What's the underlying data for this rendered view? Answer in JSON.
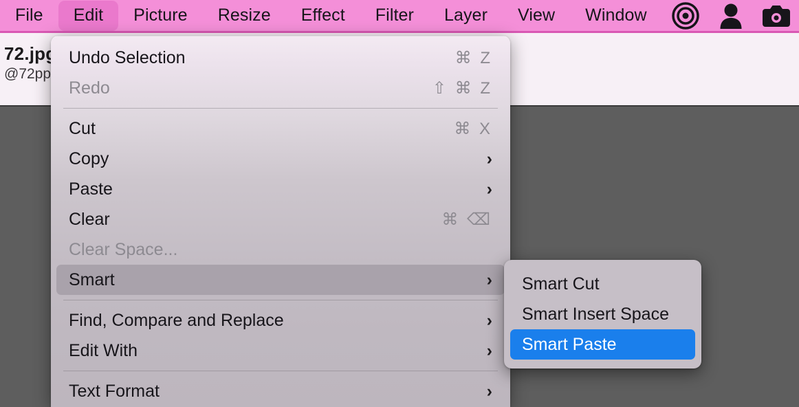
{
  "menubar": {
    "items": [
      {
        "label": "File",
        "active": false
      },
      {
        "label": "Edit",
        "active": true
      },
      {
        "label": "Picture",
        "active": false
      },
      {
        "label": "Resize",
        "active": false
      },
      {
        "label": "Effect",
        "active": false
      },
      {
        "label": "Filter",
        "active": false
      },
      {
        "label": "Layer",
        "active": false
      },
      {
        "label": "View",
        "active": false
      },
      {
        "label": "Window",
        "active": false
      }
    ],
    "icons": [
      {
        "name": "target-icon"
      },
      {
        "name": "person-icon"
      },
      {
        "name": "camera-icon"
      }
    ],
    "background_color": "#f48fd8",
    "active_color": "#ea79cc"
  },
  "document": {
    "title": "72.jpg",
    "subtitle": "@72pp"
  },
  "edit_menu": {
    "rows": [
      {
        "label": "Undo Selection",
        "shortcut": "⌘ Z",
        "arrow": "",
        "disabled": false,
        "highlighted": false
      },
      {
        "label": "Redo",
        "shortcut": "⇧ ⌘ Z",
        "arrow": "",
        "disabled": true,
        "highlighted": false
      },
      {
        "separator": true
      },
      {
        "label": "Cut",
        "shortcut": "⌘ X",
        "arrow": "",
        "disabled": false,
        "highlighted": false
      },
      {
        "label": "Copy",
        "shortcut": "",
        "arrow": "›",
        "disabled": false,
        "highlighted": false
      },
      {
        "label": "Paste",
        "shortcut": "",
        "arrow": "›",
        "disabled": false,
        "highlighted": false
      },
      {
        "label": "Clear",
        "shortcut": "⌘ ⌫",
        "arrow": "",
        "disabled": false,
        "highlighted": false
      },
      {
        "label": "Clear Space...",
        "shortcut": "",
        "arrow": "",
        "disabled": true,
        "highlighted": false
      },
      {
        "label": "Smart",
        "shortcut": "",
        "arrow": "›",
        "disabled": false,
        "highlighted": true
      },
      {
        "separator": true
      },
      {
        "label": "Find, Compare and Replace",
        "shortcut": "",
        "arrow": "›",
        "disabled": false,
        "highlighted": false
      },
      {
        "label": "Edit With",
        "shortcut": "",
        "arrow": "›",
        "disabled": false,
        "highlighted": false
      },
      {
        "separator": true
      },
      {
        "label": "Text Format",
        "shortcut": "",
        "arrow": "›",
        "disabled": false,
        "highlighted": false
      }
    ]
  },
  "smart_submenu": {
    "rows": [
      {
        "label": "Smart Cut",
        "selected": false
      },
      {
        "label": "Smart Insert Space",
        "selected": false
      },
      {
        "label": "Smart Paste",
        "selected": true
      }
    ],
    "selection_color": "#1a7fec"
  },
  "canvas": {
    "background_color": "#5e5e5e"
  }
}
